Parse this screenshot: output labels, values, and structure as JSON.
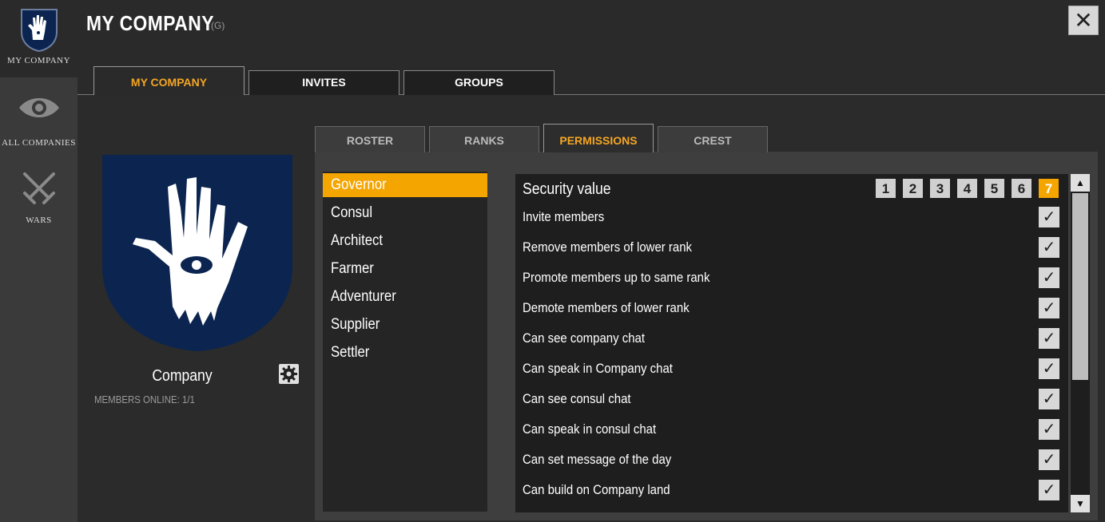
{
  "leftnav": {
    "items": [
      {
        "label": "MY COMPANY",
        "icon": "hand-crest-icon"
      },
      {
        "label": "ALL COMPANIES",
        "icon": "eye-icon"
      },
      {
        "label": "WARS",
        "icon": "crossed-swords-icon"
      }
    ]
  },
  "header": {
    "title": "MY COMPANY",
    "hotkey": "(G)",
    "close_label": "✕"
  },
  "tabs": [
    "MY COMPANY",
    "INVITES",
    "GROUPS"
  ],
  "company": {
    "name": "Company",
    "members_online": "MEMBERS ONLINE: 1/1",
    "crest_bg": "#0b2550"
  },
  "subtabs": [
    "ROSTER",
    "RANKS",
    "PERMISSIONS",
    "CREST"
  ],
  "ranks": [
    "Governor",
    "Consul",
    "Architect",
    "Farmer",
    "Adventurer",
    "Supplier",
    "Settler"
  ],
  "permissions": {
    "security_label": "Security value",
    "security_values": [
      "1",
      "2",
      "3",
      "4",
      "5",
      "6",
      "7"
    ],
    "security_selected": "7",
    "items": [
      {
        "label": "Invite members",
        "checked": "✓"
      },
      {
        "label": "Remove members of lower rank",
        "checked": "✓"
      },
      {
        "label": "Promote members up to same rank",
        "checked": "✓"
      },
      {
        "label": "Demote members of lower rank",
        "checked": "✓"
      },
      {
        "label": "Can see company chat",
        "checked": "✓"
      },
      {
        "label": "Can speak in Company chat",
        "checked": "✓"
      },
      {
        "label": "Can see consul chat",
        "checked": "✓"
      },
      {
        "label": "Can speak in consul chat",
        "checked": "✓"
      },
      {
        "label": "Can set message of the day",
        "checked": "✓"
      },
      {
        "label": "Can build on Company land",
        "checked": "✓"
      }
    ]
  },
  "scroll": {
    "up": "▲",
    "down": "▼"
  },
  "colors": {
    "accent": "#f5a623",
    "selected_bg": "#f5a500"
  }
}
